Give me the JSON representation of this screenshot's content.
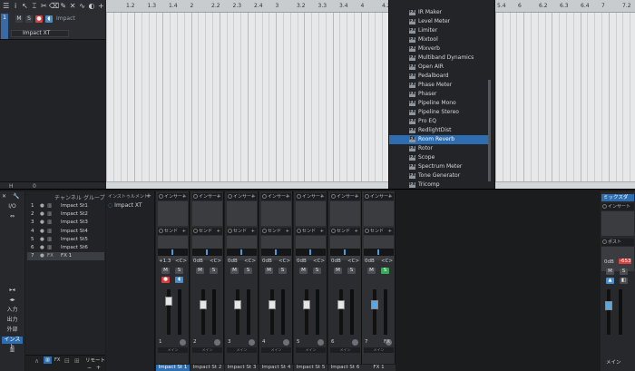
{
  "track": {
    "number": "1",
    "mute": "M",
    "solo": "S",
    "name": "Impact",
    "instrument": "Impact XT",
    "footer_left": "H",
    "footer_mid": "0"
  },
  "ruler_top": [
    "1.2",
    "1.3",
    "1.4",
    "2",
    "2.2",
    "2.3",
    "2.4",
    "3",
    "3.2",
    "3.3",
    "3.4",
    "4",
    "4.2"
  ],
  "ruler_right": [
    "5.4",
    "6",
    "6.2",
    "6.3",
    "6.4",
    "7",
    "7.2"
  ],
  "fx_menu": {
    "items": [
      "IR Maker",
      "Level Meter",
      "Limiter",
      "Mixtool",
      "Mixverb",
      "Multiband Dynamics",
      "Open AIR",
      "Pedalboard",
      "Phase Meter",
      "Phaser",
      "Pipeline Mono",
      "Pipeline Stereo",
      "Pro EQ",
      "RedlightDist",
      "Room Reverb",
      "Rotor",
      "Scope",
      "Spectrum Meter",
      "Tone Generator",
      "Tricomp"
    ],
    "selected": "Room Reverb",
    "badge": "FX"
  },
  "left_panel": {
    "io": "I/O",
    "items": [
      "入力",
      "出力",
      "外部",
      "インスト"
    ],
    "active": "インスト"
  },
  "track_list": {
    "header_channel": "チャンネル",
    "header_group": "グループ",
    "items": [
      {
        "n": "1",
        "name": "Impact St1"
      },
      {
        "n": "2",
        "name": "Impact St2"
      },
      {
        "n": "3",
        "name": "Impact St3"
      },
      {
        "n": "4",
        "name": "Impact St4"
      },
      {
        "n": "5",
        "name": "Impact St5"
      },
      {
        "n": "6",
        "name": "Impact St6"
      },
      {
        "n": "7",
        "name": "FX 1"
      }
    ],
    "fx_badge": "FX",
    "remote": "リモート"
  },
  "instrument_panel": {
    "label": "インストゥルメント",
    "plugin": "Impact XT"
  },
  "strips": [
    {
      "name": "Impact St 1",
      "num": "1",
      "vol": "+1.3",
      "pan": "<C>",
      "insert": "インサート",
      "send": "センド",
      "out": "メイン",
      "m": "M",
      "s": "S"
    },
    {
      "name": "Impact St 2",
      "num": "2",
      "vol": "0dB",
      "pan": "<C>",
      "insert": "インサート",
      "send": "センド",
      "out": "メイン",
      "m": "M",
      "s": "S"
    },
    {
      "name": "Impact St 3",
      "num": "3",
      "vol": "0dB",
      "pan": "<C>",
      "insert": "インサート",
      "send": "センド",
      "out": "メイン",
      "m": "M",
      "s": "S"
    },
    {
      "name": "Impact St 4",
      "num": "4",
      "vol": "0dB",
      "pan": "<C>",
      "insert": "インサート",
      "send": "センド",
      "out": "メイン",
      "m": "M",
      "s": "S"
    },
    {
      "name": "Impact St 5",
      "num": "5",
      "vol": "0dB",
      "pan": "<C>",
      "insert": "インサート",
      "send": "センド",
      "out": "メイン",
      "m": "M",
      "s": "S"
    },
    {
      "name": "Impact St 6",
      "num": "6",
      "vol": "0dB",
      "pan": "<C>",
      "insert": "インサート",
      "send": "センド",
      "out": "メイン",
      "m": "M",
      "s": "S"
    },
    {
      "name": "FX 1",
      "num": "7",
      "vol": "0dB",
      "pan": "<C>",
      "insert": "インサート",
      "send": "センド",
      "out": "メイン",
      "m": "M",
      "s": "S"
    }
  ],
  "main_bus": {
    "label": "ミックスダ",
    "insert": "インサート",
    "post": "ポスト",
    "vol": "0dB",
    "peak": "-653",
    "m": "M",
    "s": "S",
    "name": "メイン"
  },
  "colors": {
    "accent": "#2d6db0",
    "record": "#d8403f",
    "solo_on": "#3aa95a"
  }
}
